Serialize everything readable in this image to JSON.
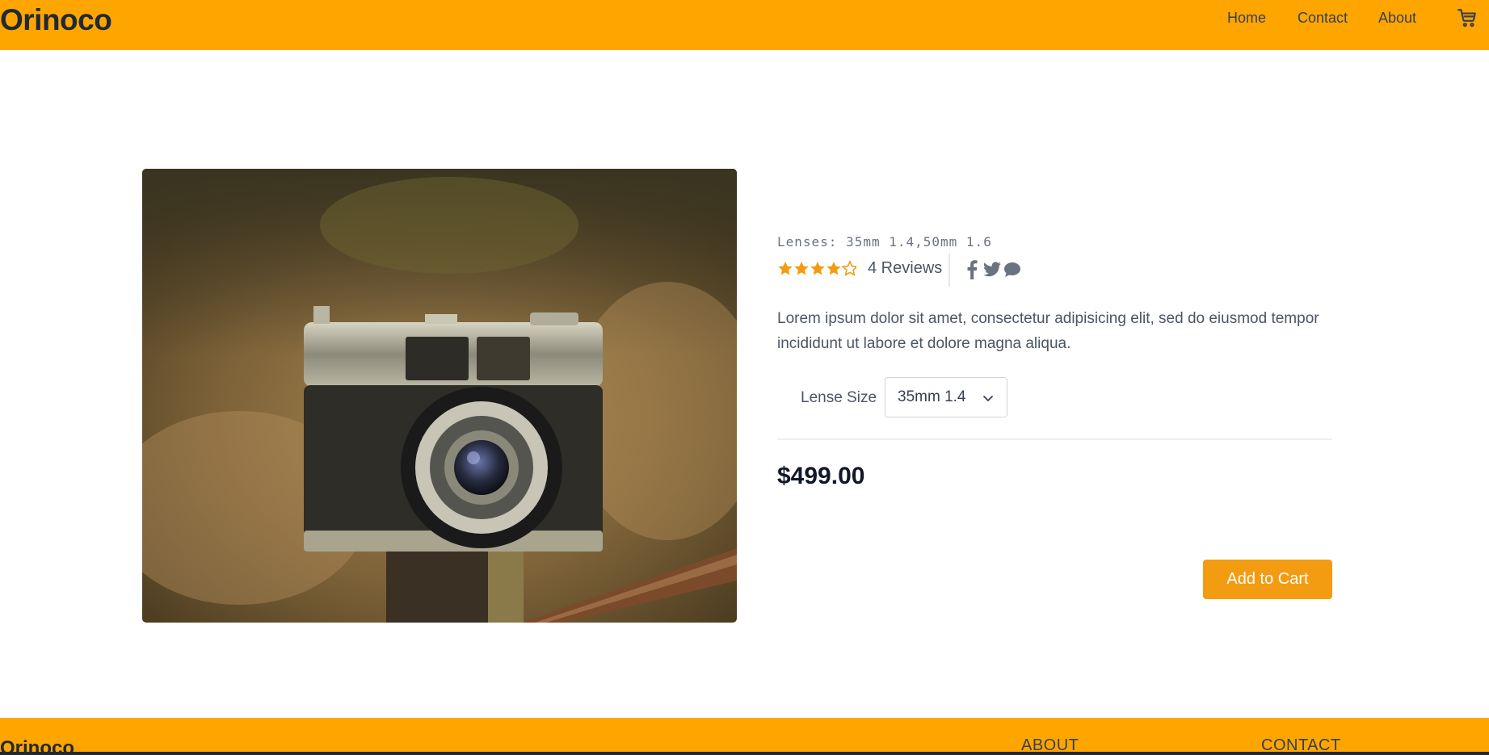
{
  "header": {
    "brand": "Orinoco",
    "nav": {
      "home": "Home",
      "contact": "Contact",
      "about": "About"
    },
    "cart_icon": "cart-icon",
    "background": "#ffa500"
  },
  "product": {
    "image_alt": "Vintage rangefinder camera on a wooden post",
    "lenses": "Lenses: 35mm 1.4,50mm 1.6",
    "rating": {
      "value": 4,
      "max": 5,
      "color": "#f39c12"
    },
    "reviews": "4 Reviews",
    "social_icons": [
      "facebook-icon",
      "twitter-icon",
      "chat-icon"
    ],
    "description": "Lorem ipsum dolor sit amet, consectetur adipisicing elit, sed do eiusmod tempor incididunt ut labore et dolore magna aliqua.",
    "lens_size": {
      "label": "Lense Size",
      "selected": "35mm 1.4"
    },
    "price": "$499.00",
    "add_to_cart": "Add to Cart",
    "button_color": "#f39c12"
  },
  "footer": {
    "brand": "Orinoco",
    "links": {
      "about": "ABOUT",
      "contact": "CONTACT"
    }
  }
}
